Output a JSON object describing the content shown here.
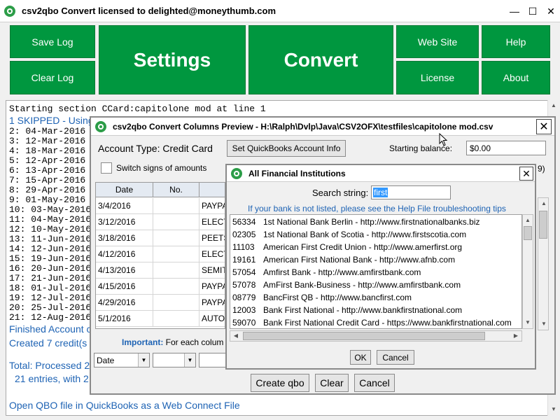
{
  "window": {
    "title": "csv2qbo Convert licensed to delighted@moneythumb.com"
  },
  "toolbar": {
    "save_log": "Save Log",
    "clear_log": "Clear Log",
    "settings": "Settings",
    "convert": "Convert",
    "web_site": "Web Site",
    "help": "Help",
    "license": "License",
    "about": "About"
  },
  "log": {
    "line0": "Starting section CCard:capitolone mod at line 1",
    "line1": "1 SKIPPED - Using",
    "entries": [
      "2: 04-Mar-2016",
      "3: 12-Mar-2016",
      "4: 18-Mar-2016",
      "5: 12-Apr-2016",
      "6: 13-Apr-2016",
      "7: 15-Apr-2016",
      "8: 29-Apr-2016",
      "9: 01-May-2016",
      "10: 03-May-2016",
      "11: 04-May-2016",
      "12: 10-May-2016",
      "13: 11-Jun-2016",
      "14: 12-Jun-2016",
      "15: 19-Jun-2016",
      "16: 20-Jun-2016",
      "17: 21-Jun-2016",
      "18: 01-Jul-2016",
      "19: 12-Jul-2016",
      "20: 25-Jul-2016",
      "21: 12-Aug-2016"
    ],
    "finished": "Finished Account c",
    "created": "Created 7 credit(s",
    "total": "Total: Processed 2",
    "total2": "21 entries, with 2",
    "open_qbo": "Open QBO file in QuickBooks as a Web Connect File"
  },
  "preview": {
    "title": "csv2qbo Convert Columns Preview - H:\\Ralph\\Dvlp\\Java\\CSV2OFX\\testfiles\\capitolone mod.csv",
    "account_type": "Account Type: Credit Card",
    "set_qb_account": "Set QuickBooks Account Info",
    "starting_balance_label": "Starting balance:",
    "starting_balance_value": "$0.00",
    "switch_signs": "Switch signs of amounts",
    "partial_right": "9)",
    "columns": [
      "Date",
      "No."
    ],
    "rows": [
      [
        "3/4/2016",
        "",
        "PAYPA"
      ],
      [
        "3/12/2016",
        "",
        "ELECT"
      ],
      [
        "3/18/2016",
        "",
        "PEETS"
      ],
      [
        "4/12/2016",
        "",
        "ELECT"
      ],
      [
        "4/13/2016",
        "",
        "SEMITC"
      ],
      [
        "4/15/2016",
        "",
        "PAYPA"
      ],
      [
        "4/29/2016",
        "",
        "PAYPA"
      ],
      [
        "5/1/2016",
        "",
        "AUTO I"
      ]
    ],
    "important_label": "Important:",
    "important_text": "For each colum",
    "combo_date": "Date",
    "create_qbo": "Create qbo",
    "clear": "Clear",
    "cancel": "Cancel"
  },
  "fi": {
    "title": "All Financial Institutions",
    "search_label": "Search string:",
    "search_value": "first",
    "help_text": "If your bank is not listed, please see the Help File troubleshooting tips",
    "items": [
      {
        "code": "56334",
        "name": "1st National Bank Berlin - http://www.firstnationalbanks.biz"
      },
      {
        "code": "02305",
        "name": "1st National Bank of Scotia - http://www.firstscotia.com"
      },
      {
        "code": "11103",
        "name": "American First Credit Union - http://www.amerfirst.org"
      },
      {
        "code": "19161",
        "name": "American First National Bank - http://www.afnb.com"
      },
      {
        "code": "57054",
        "name": "Amfirst Bank - http://www.amfirstbank.com"
      },
      {
        "code": "57078",
        "name": "AmFirst Bank-Business - http://www.amfirstbank.com"
      },
      {
        "code": "08779",
        "name": "BancFirst QB - http://www.bancfirst.com"
      },
      {
        "code": "12003",
        "name": "Bank First National - http://www.bankfirstnational.com"
      },
      {
        "code": "59070",
        "name": "Bank First National Credit Card - https://www.bankfirstnational.com"
      }
    ],
    "ok": "OK",
    "cancel": "Cancel"
  },
  "colors": {
    "accent_green": "#00973f",
    "log_blue": "#1e63b4"
  }
}
